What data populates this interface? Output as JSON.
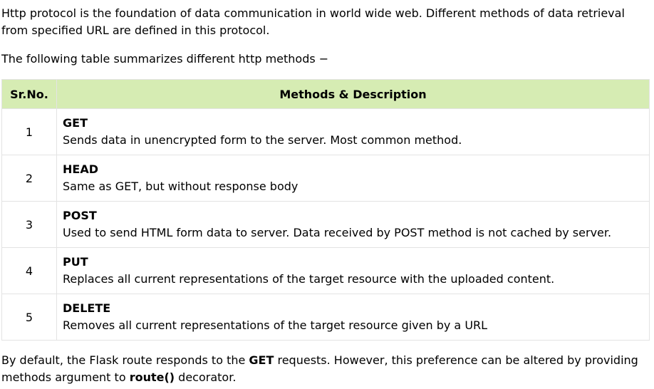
{
  "intro": {
    "paragraph1": "Http protocol is the foundation of data communication in world wide web. Different methods of data retrieval from specified URL are defined in this protocol.",
    "paragraph2": "The following table summarizes different http methods −"
  },
  "table": {
    "headers": [
      "Sr.No.",
      "Methods & Description"
    ],
    "rows": [
      {
        "num": "1",
        "method": "GET",
        "description": "Sends data in unencrypted form to the server. Most common method."
      },
      {
        "num": "2",
        "method": "HEAD",
        "description": "Same as GET, but without response body"
      },
      {
        "num": "3",
        "method": "POST",
        "description": "Used to send HTML form data to server. Data received by POST method is not cached by server."
      },
      {
        "num": "4",
        "method": "PUT",
        "description": "Replaces all current representations of the target resource with the uploaded content."
      },
      {
        "num": "5",
        "method": "DELETE",
        "description": "Removes all current representations of the target resource given by a URL"
      }
    ]
  },
  "outro": {
    "text_before": "By default, the Flask route responds to the ",
    "bold_get": "GET",
    "text_middle": " requests. However, this preference can be altered by providing methods argument to ",
    "bold_route": "route()",
    "text_after": " decorator."
  },
  "colors": {
    "header_bg": "#d6ecb3",
    "border": "#e3e3e3"
  }
}
